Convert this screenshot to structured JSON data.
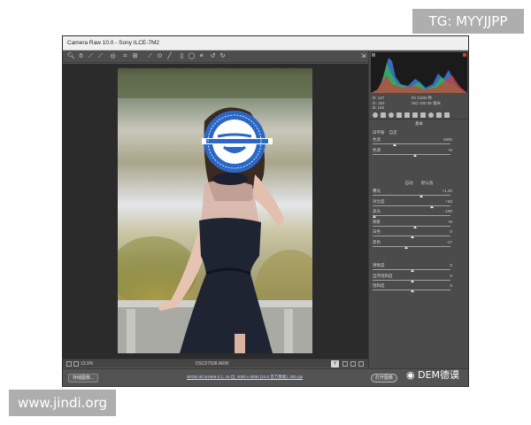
{
  "watermarks": {
    "top": "TG: MYYJJPP",
    "bottom": "www.jindi.org",
    "weibo": "DEM德谟"
  },
  "window": {
    "title": "Camera Raw 10.0 - Sony ILCE-7M2"
  },
  "toolbar": {
    "tools": [
      "zoom-icon",
      "hand-icon",
      "white-balance-icon",
      "color-sampler-icon",
      "target-adjust-icon",
      "crop-icon",
      "straighten-icon",
      "spot-removal-icon",
      "red-eye-icon",
      "brush-icon",
      "graduated-filter-icon",
      "radial-filter-icon",
      "preferences-icon",
      "rotate-left-icon",
      "rotate-right-icon"
    ],
    "export": "export-icon"
  },
  "status": {
    "zoom": "13.9%",
    "filename": "DSC07508.ARW",
    "preview_toggle": "Y"
  },
  "bottombar": {
    "save_label": "存储图像...",
    "workflow_text": "sRGB IEC61966-2.1; 16 位; 4000 x 6000 (24.0 百万像素); 300 ppi",
    "open_label": "打开图像"
  },
  "readout": {
    "r": "R: 147",
    "g": "G: 152",
    "b": "B: 145",
    "aperture_shutter": "f/2    1/200 秒",
    "iso_focal": "ISO 100    35 毫米"
  },
  "panel": {
    "title": "基本",
    "wb_label": "白平衡",
    "wb_value": "自定",
    "auto_label": "自动",
    "default_label": "默认值",
    "temp_sliders": [
      {
        "label": "色温",
        "value": "4600",
        "pos": 0.27
      },
      {
        "label": "色调",
        "value": "+6",
        "pos": 0.53
      }
    ],
    "tone_sliders": [
      {
        "label": "曝光",
        "value": "+1.20",
        "pos": 0.62
      },
      {
        "label": "对比度",
        "value": "+53",
        "pos": 0.76
      },
      {
        "label": "高光",
        "value": "-100",
        "pos": 0.0
      },
      {
        "label": "阴影",
        "value": "+6",
        "pos": 0.53
      },
      {
        "label": "白色",
        "value": "0",
        "pos": 0.5
      },
      {
        "label": "黑色",
        "value": "-17",
        "pos": 0.42
      }
    ],
    "presence_sliders": [
      {
        "label": "清晰度",
        "value": "0",
        "pos": 0.5
      },
      {
        "label": "自然饱和度",
        "value": "0",
        "pos": 0.5
      },
      {
        "label": "饱和度",
        "value": "0",
        "pos": 0.5
      }
    ]
  },
  "colors": {
    "window_bg": "#535353",
    "panel_bg": "#4b4b4b",
    "canvas_bg": "#2b2b2b",
    "sticker_blue": "#2b68c6"
  },
  "sticker": {
    "ring_text": "I thought what I'd do was, I'd pretend I was one of those deaf-mutes"
  }
}
